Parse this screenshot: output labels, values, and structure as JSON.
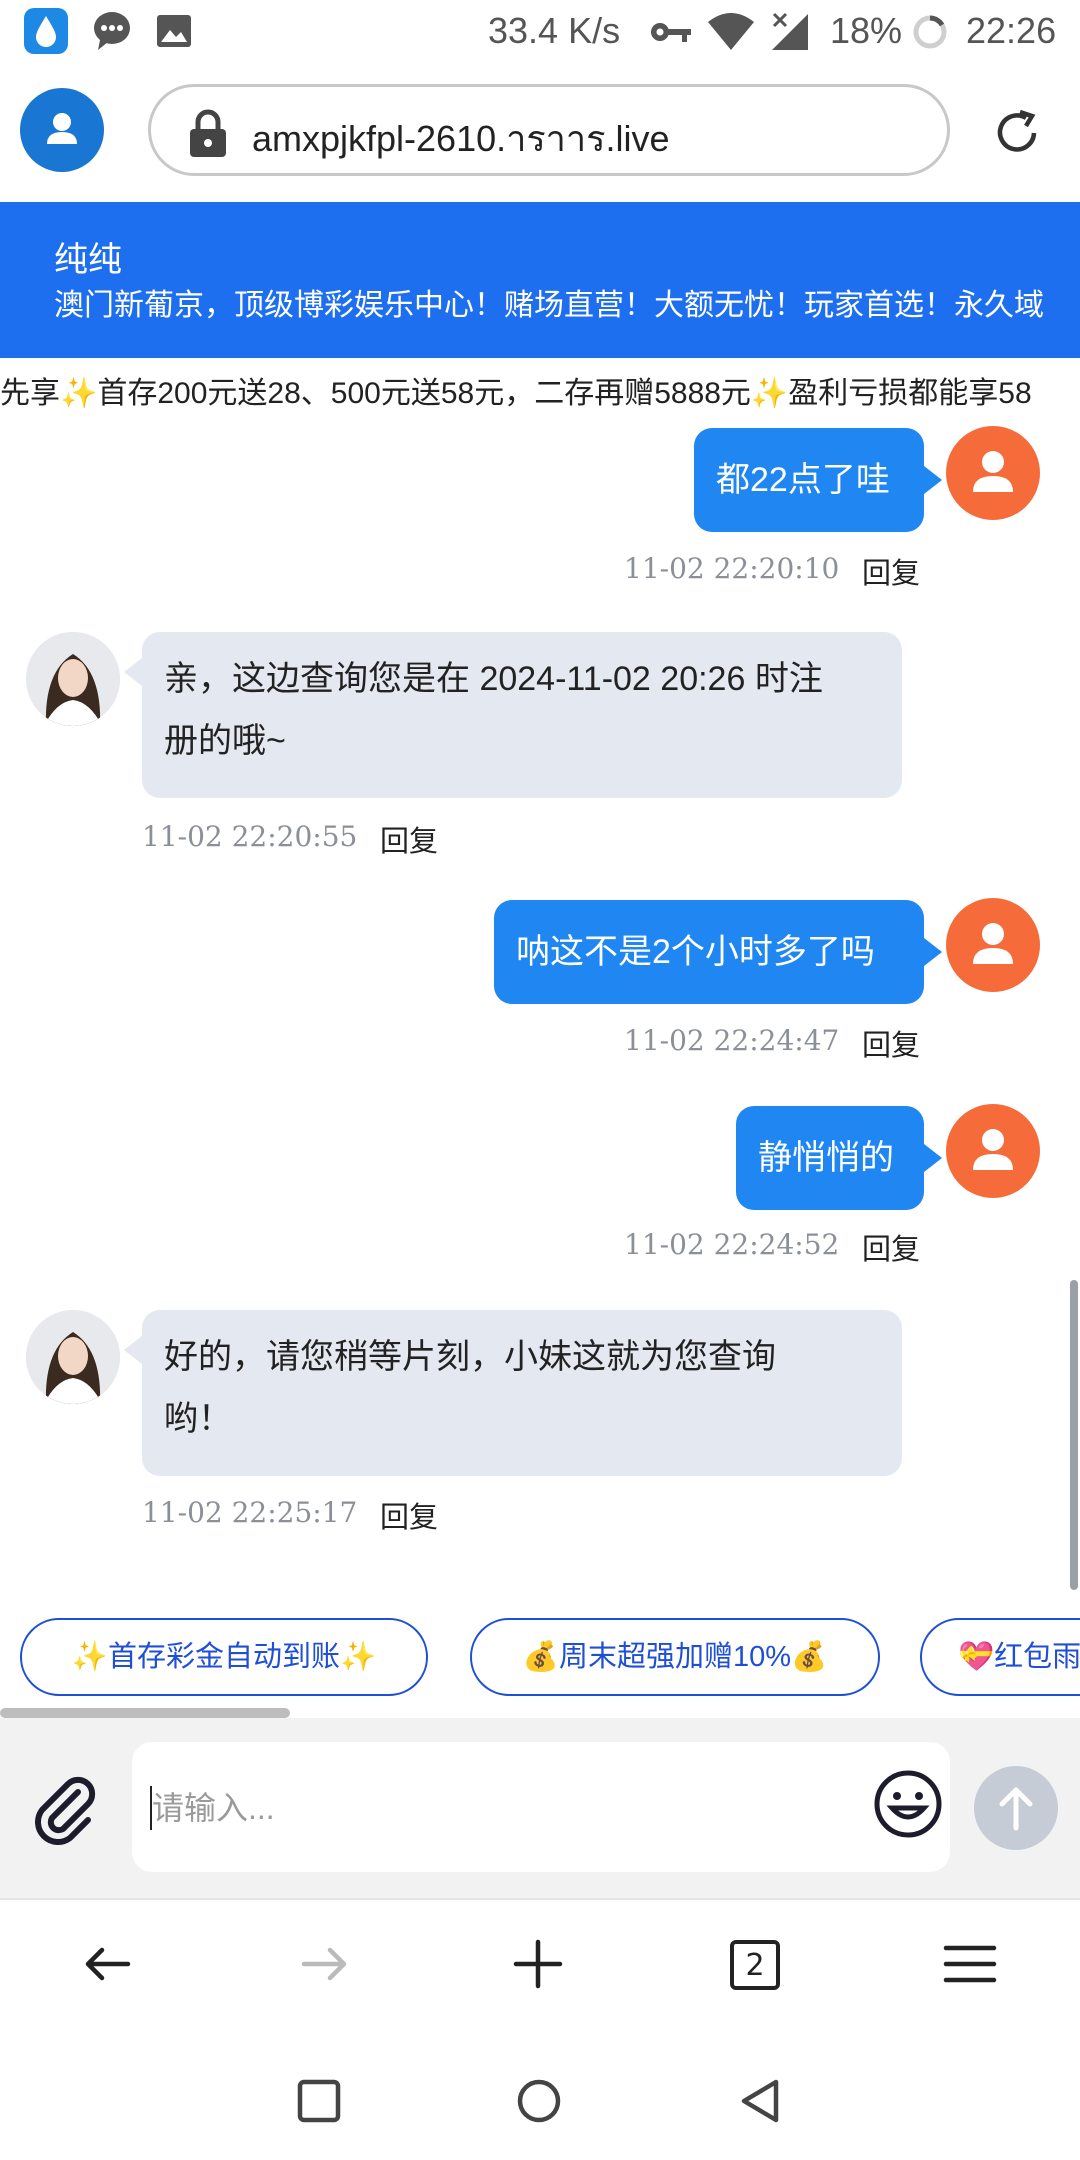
{
  "status_bar": {
    "speed": "33.4 K/s",
    "battery": "18%",
    "time": "22:26"
  },
  "browser": {
    "url": "amxpjkfpl-2610.าราาร.live"
  },
  "banner": {
    "title": "纯纯",
    "subtitle": "澳门新葡京，顶级博彩娱乐中心！赌场直营！大额无忧！玩家首选！永久域"
  },
  "marquee": {
    "text": "先享✨首存200元送28、500元送58元，二存再赠5888元✨盈利亏损都能享58"
  },
  "messages": [
    {
      "side": "me",
      "text": "都22点了哇",
      "time": "11-02 22:20:10",
      "reply": "回复"
    },
    {
      "side": "them",
      "text_line1": "亲，这边查询您是在 2024-11-02 20:26 时注",
      "text_line2": "册的哦~",
      "time": "11-02 22:20:55",
      "reply": "回复"
    },
    {
      "side": "me",
      "text": "呐这不是2个小时多了吗",
      "time": "11-02 22:24:47",
      "reply": "回复"
    },
    {
      "side": "me",
      "text": "静悄悄的",
      "time": "11-02 22:24:52",
      "reply": "回复"
    },
    {
      "side": "them",
      "text_line1": "好的，请您稍等片刻，小妹这就为您查询",
      "text_line2": "哟！",
      "time": "11-02 22:25:17",
      "reply": "回复"
    }
  ],
  "quick_replies": [
    "✨首存彩金自动到账✨",
    "💰周末超强加赠10%💰",
    "💝红包雨"
  ],
  "composer": {
    "placeholder": "请输入..."
  },
  "tabs_count": "2",
  "colors": {
    "accent_blue": "#1e6ff0",
    "my_bubble": "#1f86f2",
    "their_bubble": "#e3e8f1",
    "my_avatar": "#f66b3a"
  }
}
